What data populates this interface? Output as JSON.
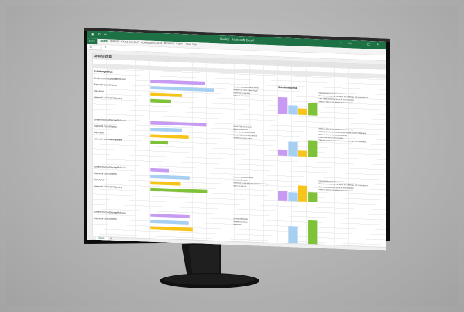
{
  "window": {
    "title": "Book1 - Microsoft Excel",
    "quick_access": "▣ ↶ ↷",
    "controls": "? ▭ – ▢ ✕"
  },
  "tabs": [
    {
      "label": "FILE"
    },
    {
      "label": "HOME"
    },
    {
      "label": "INSERT"
    },
    {
      "label": "PAGE LAYOUT"
    },
    {
      "label": "FORMULAS"
    },
    {
      "label": "DATA"
    },
    {
      "label": "REVIEW"
    },
    {
      "label": "VIEW"
    },
    {
      "label": "NEW TAB"
    }
  ],
  "formula_bar": {
    "name_box": "A1",
    "fx": "fx"
  },
  "sheet": {
    "title": "General 2013",
    "section_title": "Solutiongebrica",
    "chart_title": "Solutiongebrica",
    "row_labels": [
      "Sundmentum Adipiscing Ridiculus",
      "Adipiscing Sem Pharetra",
      "Cras Amet",
      "Venenatis Vehicula Adipiscing"
    ],
    "notes_a": [
      "Cuisque Malesuada Ultrices Aenean",
      "Praesent commodo cursus magna",
      "Cras mattis consectetur",
      "Nullam id dolor id nibh"
    ],
    "notes_b": [
      "Donec id elit non mi porta",
      "Integer posuere erat",
      "Nullam id dolor id nibh ultricies",
      "Donec id elit non mi porta gravida",
      "Praesent commodo cursus"
    ],
    "notes_c": [
      "Cuisque Malesuada Ultrices",
      "Praesent commodo",
      "Cras mattis consectetur purus sit amet fermentum",
      "Nullam id dolor id"
    ],
    "notes_d": [
      "Cuisque Malesuada",
      "Praesent commodo",
      "Cras mattis"
    ],
    "right_notes": [
      "Cuisque Malesuada Ultrices Aenean",
      "Praesent commodo cursus magna, vel scelerisque nisl consectetur et.",
      "Cras mattis consectetur purus sit amet fermentum.",
      "Nullam id dolor id nibh ultricies vehicula ut id elit."
    ],
    "right_notes_b": [
      "Nullam id dolor id nibh ultricies vehicula ut id elit.",
      "Integer posuere erat a ante venenatis dapibus posuere velit aliquet.",
      "Nullam id dolor id nibh ultricies vehicula.",
      "Donec id elit non mi porta gravida.",
      "Praesent commodo cursus magna, vel scelerisque nisl consectetur."
    ],
    "right_notes_c": [
      "Cuisque Malesuada Ultrices Aenean",
      "Praesent commodo cursus magna, vel scelerisque nisl consectetur et.",
      "Cras mattis consectetur purus sit amet fermentum.",
      "Nullam id dolor id nibh ultricies vehicula ut id elit."
    ],
    "sheet_tab": "Sheet1",
    "sheet_add": "⊕"
  },
  "colors": {
    "purple": "#c79bf2",
    "blue": "#a6cff2",
    "yellow": "#f7c51a",
    "green": "#7fc23a",
    "excel_green": "#1e7145"
  },
  "groups": [
    {
      "bars": [
        0.86,
        1.0,
        0.5,
        0.32
      ],
      "vbars": [
        0.85,
        0.45,
        0.32,
        0.62
      ]
    },
    {
      "bars": [
        0.88,
        0.5,
        0.6,
        0.28
      ],
      "vbars": [
        0.3,
        0.72,
        0.28,
        0.82
      ]
    },
    {
      "bars": [
        0.3,
        0.62,
        0.48,
        0.9
      ],
      "vbars": [
        0.5,
        0.45,
        0.8,
        0.48
      ]
    },
    {
      "bars": [
        0.62,
        0.6
      ]
    }
  ]
}
